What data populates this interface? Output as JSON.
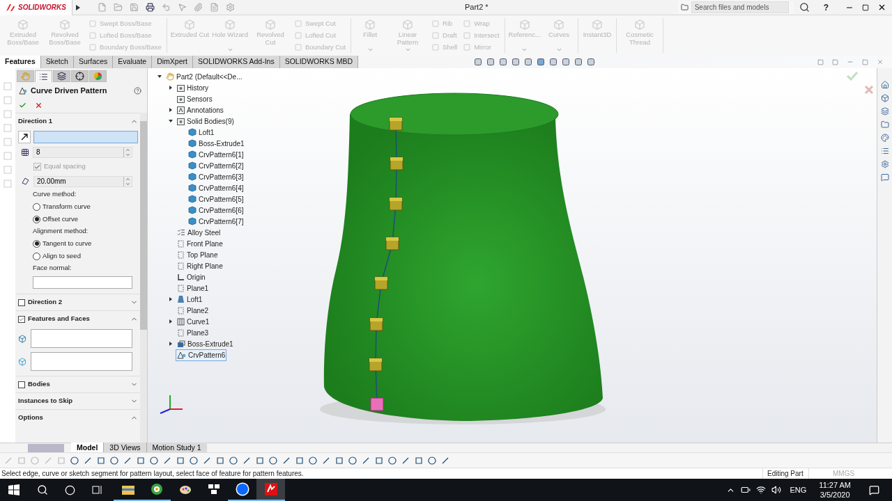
{
  "title_bar": {
    "logo_text": "SOLIDWORKS",
    "document_title": "Part2 *",
    "search": {
      "placeholder": "Search files and models"
    },
    "help": "?"
  },
  "ribbon": {
    "groups": [
      {
        "columns": [
          {
            "kind": "large",
            "label": "Extruded Boss/Base",
            "disabled": true,
            "dropdown": false
          },
          {
            "kind": "large",
            "label": "Revolved Boss/Base",
            "disabled": true,
            "dropdown": false
          },
          {
            "kind": "stack",
            "items": [
              {
                "label": "Swept Boss/Base",
                "disabled": true
              },
              {
                "label": "Lofted Boss/Base",
                "disabled": true
              },
              {
                "label": "Boundary Boss/Base",
                "disabled": true
              }
            ]
          }
        ]
      },
      {
        "columns": [
          {
            "kind": "large",
            "label": "Extruded Cut",
            "disabled": true,
            "dropdown": false
          },
          {
            "kind": "large",
            "label": "Hole Wizard",
            "disabled": true,
            "dropdown": true
          },
          {
            "kind": "large",
            "label": "Revolved Cut",
            "disabled": true,
            "dropdown": false
          },
          {
            "kind": "stack",
            "items": [
              {
                "label": "Swept Cut",
                "disabled": true
              },
              {
                "label": "Lofted Cut",
                "disabled": true
              },
              {
                "label": "Boundary Cut",
                "disabled": true
              }
            ]
          }
        ]
      },
      {
        "columns": [
          {
            "kind": "large",
            "label": "Fillet",
            "disabled": true,
            "dropdown": true
          },
          {
            "kind": "large",
            "label": "Linear Pattern",
            "disabled": true,
            "dropdown": true
          },
          {
            "kind": "stack",
            "items": [
              {
                "label": "Rib",
                "disabled": true
              },
              {
                "label": "Draft",
                "disabled": true
              },
              {
                "label": "Shell",
                "disabled": true
              }
            ]
          },
          {
            "kind": "stack",
            "items": [
              {
                "label": "Wrap",
                "disabled": true
              },
              {
                "label": "Intersect",
                "disabled": true
              },
              {
                "label": "Mirror",
                "disabled": true
              }
            ]
          }
        ]
      },
      {
        "columns": [
          {
            "kind": "large",
            "label": "Referenc...",
            "disabled": true,
            "dropdown": true
          },
          {
            "kind": "large",
            "label": "Curves",
            "disabled": true,
            "dropdown": true
          }
        ]
      },
      {
        "columns": [
          {
            "kind": "large",
            "label": "Instant3D",
            "disabled": true,
            "dropdown": false
          }
        ]
      },
      {
        "columns": [
          {
            "kind": "large",
            "label": "Cosmetic Thread",
            "disabled": true,
            "dropdown": false
          }
        ]
      }
    ]
  },
  "command_tabs": [
    {
      "label": "Features",
      "selected": true
    },
    {
      "label": "Sketch",
      "selected": false
    },
    {
      "label": "Surfaces",
      "selected": false
    },
    {
      "label": "Evaluate",
      "selected": false
    },
    {
      "label": "DimXpert",
      "selected": false
    },
    {
      "label": "SOLIDWORKS Add-Ins",
      "selected": false
    },
    {
      "label": "SOLIDWORKS MBD",
      "selected": false
    }
  ],
  "property_manager": {
    "panel_tabs": [
      {
        "kind": "feature",
        "selected": false
      },
      {
        "kind": "property",
        "selected": true
      },
      {
        "kind": "configuration",
        "selected": false
      },
      {
        "kind": "dimxpert",
        "selected": false
      },
      {
        "kind": "display",
        "selected": false
      }
    ],
    "title": "Curve Driven Pattern",
    "sections": [
      {
        "title": "Direction 1",
        "expanded": true,
        "rows": [
          {
            "kind": "selection",
            "active": true
          },
          {
            "kind": "spin",
            "value": "8"
          },
          {
            "kind": "checkbox",
            "label": "Equal spacing",
            "checked": true,
            "disabled": true
          },
          {
            "kind": "spin",
            "value": "20.00mm"
          },
          {
            "kind": "label",
            "text": "Curve method:"
          },
          {
            "kind": "radio",
            "label": "Transform curve",
            "selected": false
          },
          {
            "kind": "radio",
            "label": "Offset curve",
            "selected": true
          },
          {
            "kind": "label",
            "text": "Alignment method:"
          },
          {
            "kind": "radio",
            "label": "Tangent to curve",
            "selected": true
          },
          {
            "kind": "radio",
            "label": "Align to seed",
            "selected": false
          },
          {
            "kind": "label",
            "text": "Face normal:"
          },
          {
            "kind": "list_box"
          }
        ]
      },
      {
        "title": "Direction 2",
        "checked": false,
        "expanded": false
      },
      {
        "title": "Features and Faces",
        "checked": true,
        "expanded": true,
        "rows": [
          {
            "kind": "list_box"
          },
          {
            "kind": "list_box"
          }
        ]
      },
      {
        "title": "Bodies",
        "checked": false,
        "expanded": false
      },
      {
        "title": "Instances to Skip",
        "expanded": false
      },
      {
        "title": "Options",
        "expanded": true
      }
    ]
  },
  "feature_tree": {
    "label": "Part2  (Default<<De...",
    "kind": "part",
    "expanded": true,
    "selected": false,
    "children": [
      {
        "label": "History",
        "kind": "folder",
        "expanded": false,
        "selected": false
      },
      {
        "label": "Sensors",
        "kind": "folder",
        "selected": false
      },
      {
        "label": "Annotations",
        "kind": "annotation",
        "expanded": false,
        "selected": false
      },
      {
        "label": "Solid Bodies(9)",
        "kind": "folder",
        "expanded": true,
        "selected": false,
        "children": [
          {
            "label": "Loft1",
            "kind": "body",
            "selected": false
          },
          {
            "label": "Boss-Extrude1",
            "kind": "body",
            "selected": false
          },
          {
            "label": "CrvPattern6[1]",
            "kind": "body",
            "selected": false
          },
          {
            "label": "CrvPattern6[2]",
            "kind": "body",
            "selected": false
          },
          {
            "label": "CrvPattern6[3]",
            "kind": "body",
            "selected": false
          },
          {
            "label": "CrvPattern6[4]",
            "kind": "body",
            "selected": false
          },
          {
            "label": "CrvPattern6[5]",
            "kind": "body",
            "selected": false
          },
          {
            "label": "CrvPattern6[6]",
            "kind": "body",
            "selected": false
          },
          {
            "label": "CrvPattern6[7]",
            "kind": "body",
            "selected": false
          }
        ]
      },
      {
        "label": "Alloy Steel",
        "kind": "material",
        "selected": false
      },
      {
        "label": "Front Plane",
        "kind": "plane",
        "selected": false
      },
      {
        "label": "Top Plane",
        "kind": "plane",
        "selected": false
      },
      {
        "label": "Right Plane",
        "kind": "plane",
        "selected": false
      },
      {
        "label": "Origin",
        "kind": "origin",
        "selected": false
      },
      {
        "label": "Plane1",
        "kind": "plane",
        "selected": false
      },
      {
        "label": "Loft1",
        "kind": "loft",
        "expanded": false,
        "selected": false
      },
      {
        "label": "Plane2",
        "kind": "plane",
        "selected": false
      },
      {
        "label": "Curve1",
        "kind": "curve",
        "expanded": false,
        "selected": false
      },
      {
        "label": "Plane3",
        "kind": "plane",
        "selected": false
      },
      {
        "label": "Boss-Extrude1",
        "kind": "extrude",
        "expanded": false,
        "selected": false
      },
      {
        "label": "CrvPattern6",
        "kind": "pattern",
        "selected": true
      }
    ]
  },
  "bottom_tabs": [
    {
      "label": "Model",
      "selected": true
    },
    {
      "label": "3D Views",
      "selected": false
    },
    {
      "label": "Motion Study 1",
      "selected": false
    }
  ],
  "status_bar": {
    "message": "Select edge, curve or sketch segment for pattern layout, select face of feature for pattern features.",
    "mode": "Editing Part",
    "units": "MMGS"
  },
  "taskbar": {
    "apps": [
      {
        "kind": "explorer",
        "open": true,
        "selected": false
      },
      {
        "kind": "browser",
        "open": true,
        "selected": false
      },
      {
        "kind": "paint",
        "open": false,
        "selected": false
      },
      {
        "kind": "tiles",
        "open": false,
        "selected": false
      },
      {
        "kind": "chat",
        "open": true,
        "selected": false
      },
      {
        "kind": "cad",
        "open": true,
        "selected": true
      }
    ],
    "language": "ENG",
    "time": "11:27 AM",
    "date": "3/5/2020"
  }
}
